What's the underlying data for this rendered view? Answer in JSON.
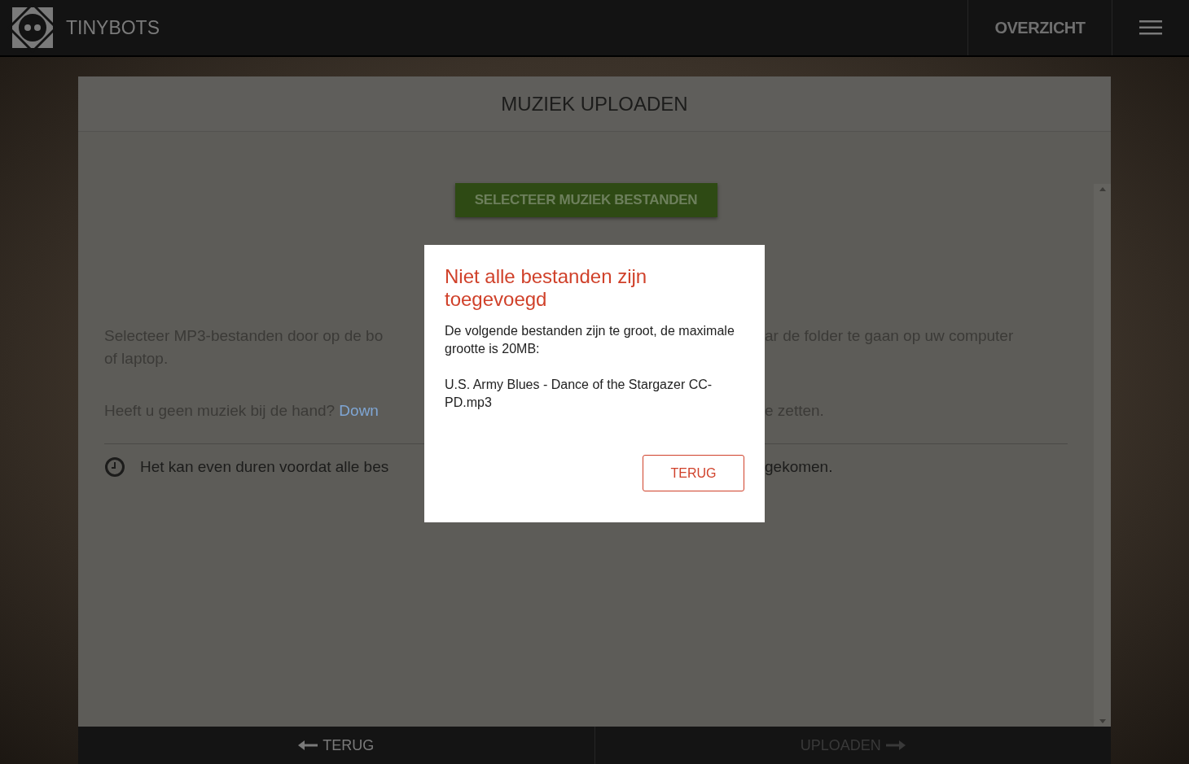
{
  "header": {
    "brand": "TINYBOTS",
    "nav": [
      {
        "label": "OVERZICHT"
      }
    ]
  },
  "panel": {
    "title": "MUZIEK UPLOADEN",
    "select_button": "SELECTEER MUZIEK BESTANDEN",
    "lines": [
      {
        "kind": "text",
        "left": "Selecteer MP3-bestanden door op de bo",
        "right": "ar de folder te gaan op uw computer"
      },
      {
        "kind": "text",
        "left": "of laptop."
      },
      {
        "kind": "link",
        "left": "Heeft u geen muziek bij de hand? ",
        "link": "Down",
        "right": "e zetten."
      },
      {
        "kind": "note",
        "left": "Het kan even duren voordat alle bes",
        "right": "gekomen."
      }
    ]
  },
  "footer": [
    {
      "label": "TERUG",
      "kind": "back",
      "disabled": false
    },
    {
      "label": "UPLOADEN",
      "kind": "forward",
      "disabled": true
    }
  ],
  "dialog": {
    "title": "Niet alle bestanden zijn toegevoegd",
    "message": "De volgende bestanden zijn te groot, de maximale grootte is 20MB:",
    "files": [
      "U.S. Army Blues - Dance of the Stargazer CC-PD.mp3"
    ],
    "button": "TERUG"
  }
}
